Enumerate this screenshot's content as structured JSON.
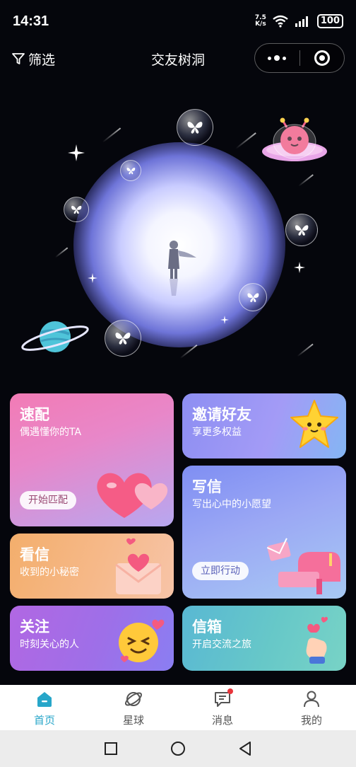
{
  "status_bar": {
    "time": "14:31",
    "net_speed_value": "7.5",
    "net_speed_unit": "K/s",
    "battery": "100"
  },
  "nav": {
    "filter_label": "筛选",
    "title": "交友树洞"
  },
  "cards": {
    "match": {
      "title": "速配",
      "subtitle": "偶遇懂你的TA",
      "action": "开始匹配"
    },
    "invite": {
      "title": "邀请好友",
      "subtitle": "享更多权益"
    },
    "read": {
      "title": "看信",
      "subtitle": "收到的小秘密"
    },
    "write": {
      "title": "写信",
      "subtitle": "写出心中的小愿望",
      "action": "立即行动"
    },
    "follow": {
      "title": "关注",
      "subtitle": "时刻关心的人"
    },
    "mailbox": {
      "title": "信箱",
      "subtitle": "开启交流之旅"
    }
  },
  "tabs": [
    {
      "label": "首页",
      "icon": "home-icon",
      "active": true
    },
    {
      "label": "星球",
      "icon": "planet-icon",
      "active": false
    },
    {
      "label": "消息",
      "icon": "message-icon",
      "active": false,
      "badge": true
    },
    {
      "label": "我的",
      "icon": "user-icon",
      "active": false
    }
  ],
  "colors": {
    "accent": "#27a6c9",
    "background": "#05060c",
    "badge": "#e8343a"
  }
}
